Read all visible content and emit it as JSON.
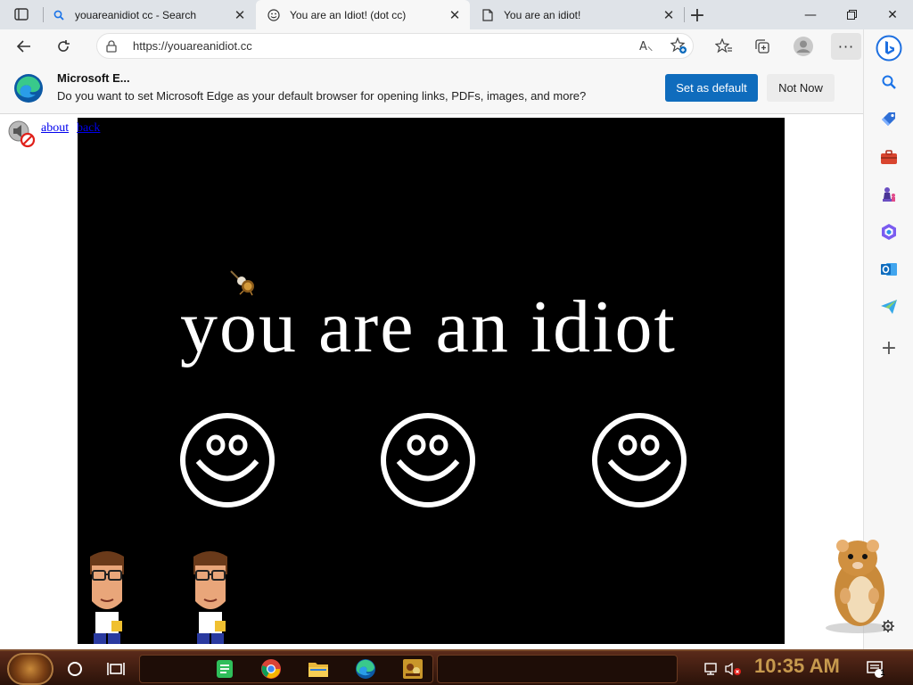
{
  "tabs": [
    {
      "title": "youareanidiot cc - Search",
      "icon": "search-icon"
    },
    {
      "title": "You are an Idiot! (dot cc)",
      "icon": "smiley-icon"
    },
    {
      "title": "You are an idiot!",
      "icon": "page-icon"
    }
  ],
  "address": {
    "url": "https://youareanidiot.cc"
  },
  "infobar": {
    "title": "Microsoft E...",
    "message": "Do you want to set Microsoft Edge as your default browser for opening links, PDFs, images, and more?",
    "primary_label": "Set as default",
    "secondary_label": "Not Now"
  },
  "page": {
    "about_label": "about",
    "back_label": "back",
    "headline": "you are an idiot"
  },
  "taskbar": {
    "clock": "10:35 AM",
    "notification_count": "1"
  },
  "colors": {
    "accent": "#0f6cbd",
    "stage": "#000000",
    "taskbar": "#3a1a0a",
    "clock": "#c79a4e"
  }
}
